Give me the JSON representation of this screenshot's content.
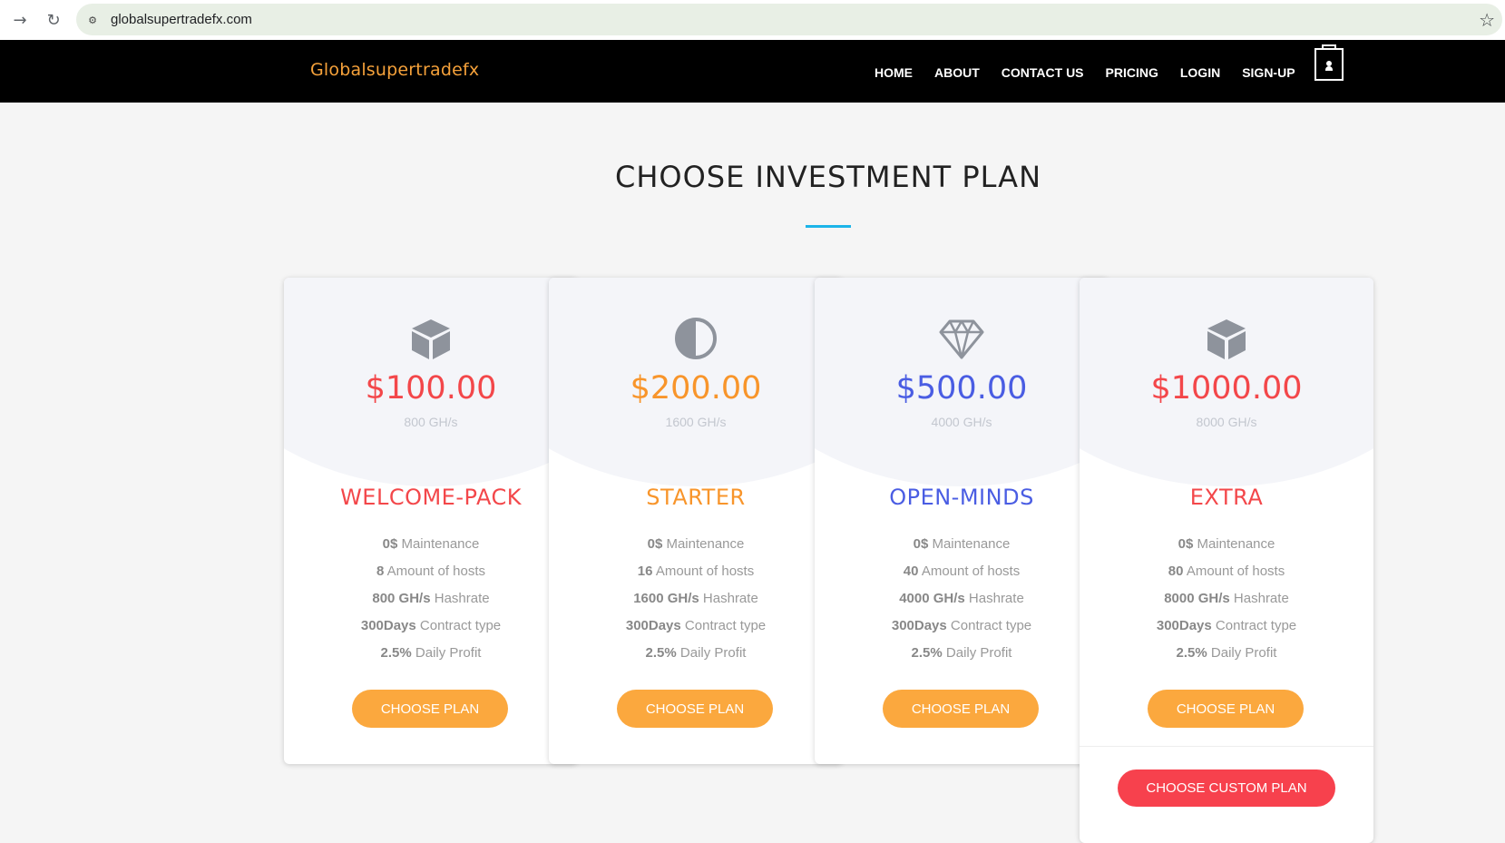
{
  "browser": {
    "back": "→",
    "reload": "↻",
    "url": "globalsupertradefx.com",
    "bookmark": "☆"
  },
  "site": {
    "brand": "Globalsupertradefx",
    "nav": [
      "HOME",
      "ABOUT",
      "CONTACT US",
      "PRICING",
      "LOGIN",
      "SIGN-UP"
    ]
  },
  "section": {
    "title": "CHOOSE INVESTMENT PLAN"
  },
  "plans": [
    {
      "icon": "cube-icon",
      "price": "$100.00",
      "rate": "800 GH/s",
      "name": "WELCOME-PACK",
      "color": "#f3474a",
      "features": [
        {
          "bold": "0$",
          "text": "Maintenance"
        },
        {
          "bold": "8",
          "text": "Amount of hosts"
        },
        {
          "bold": "800 GH/s",
          "text": "Hashrate"
        },
        {
          "bold": "300Days",
          "text": "Contract type"
        },
        {
          "bold": "2.5%",
          "text": "Daily Profit"
        }
      ],
      "button": "CHOOSE PLAN"
    },
    {
      "icon": "half-circle-icon",
      "price": "$200.00",
      "rate": "1600 GH/s",
      "name": "STARTER",
      "color": "#f8952b",
      "features": [
        {
          "bold": "0$",
          "text": "Maintenance"
        },
        {
          "bold": "16",
          "text": "Amount of hosts"
        },
        {
          "bold": "1600 GH/s",
          "text": "Hashrate"
        },
        {
          "bold": "300Days",
          "text": "Contract type"
        },
        {
          "bold": "2.5%",
          "text": "Daily Profit"
        }
      ],
      "button": "CHOOSE PLAN"
    },
    {
      "icon": "diamond-icon",
      "price": "$500.00",
      "rate": "4000 GH/s",
      "name": "OPEN-MINDS",
      "color": "#4a5de3",
      "features": [
        {
          "bold": "0$",
          "text": "Maintenance"
        },
        {
          "bold": "40",
          "text": "Amount of hosts"
        },
        {
          "bold": "4000 GH/s",
          "text": "Hashrate"
        },
        {
          "bold": "300Days",
          "text": "Contract type"
        },
        {
          "bold": "2.5%",
          "text": "Daily Profit"
        }
      ],
      "button": "CHOOSE PLAN"
    },
    {
      "icon": "cube-icon",
      "price": "$1000.00",
      "rate": "8000 GH/s",
      "name": "EXTRA",
      "color": "#f3474a",
      "features": [
        {
          "bold": "0$",
          "text": "Maintenance"
        },
        {
          "bold": "80",
          "text": "Amount of hosts"
        },
        {
          "bold": "8000 GH/s",
          "text": "Hashrate"
        },
        {
          "bold": "300Days",
          "text": "Contract type"
        },
        {
          "bold": "2.5%",
          "text": "Daily Profit"
        }
      ],
      "button": "CHOOSE PLAN",
      "custom_button": "CHOOSE CUSTOM PLAN"
    }
  ]
}
